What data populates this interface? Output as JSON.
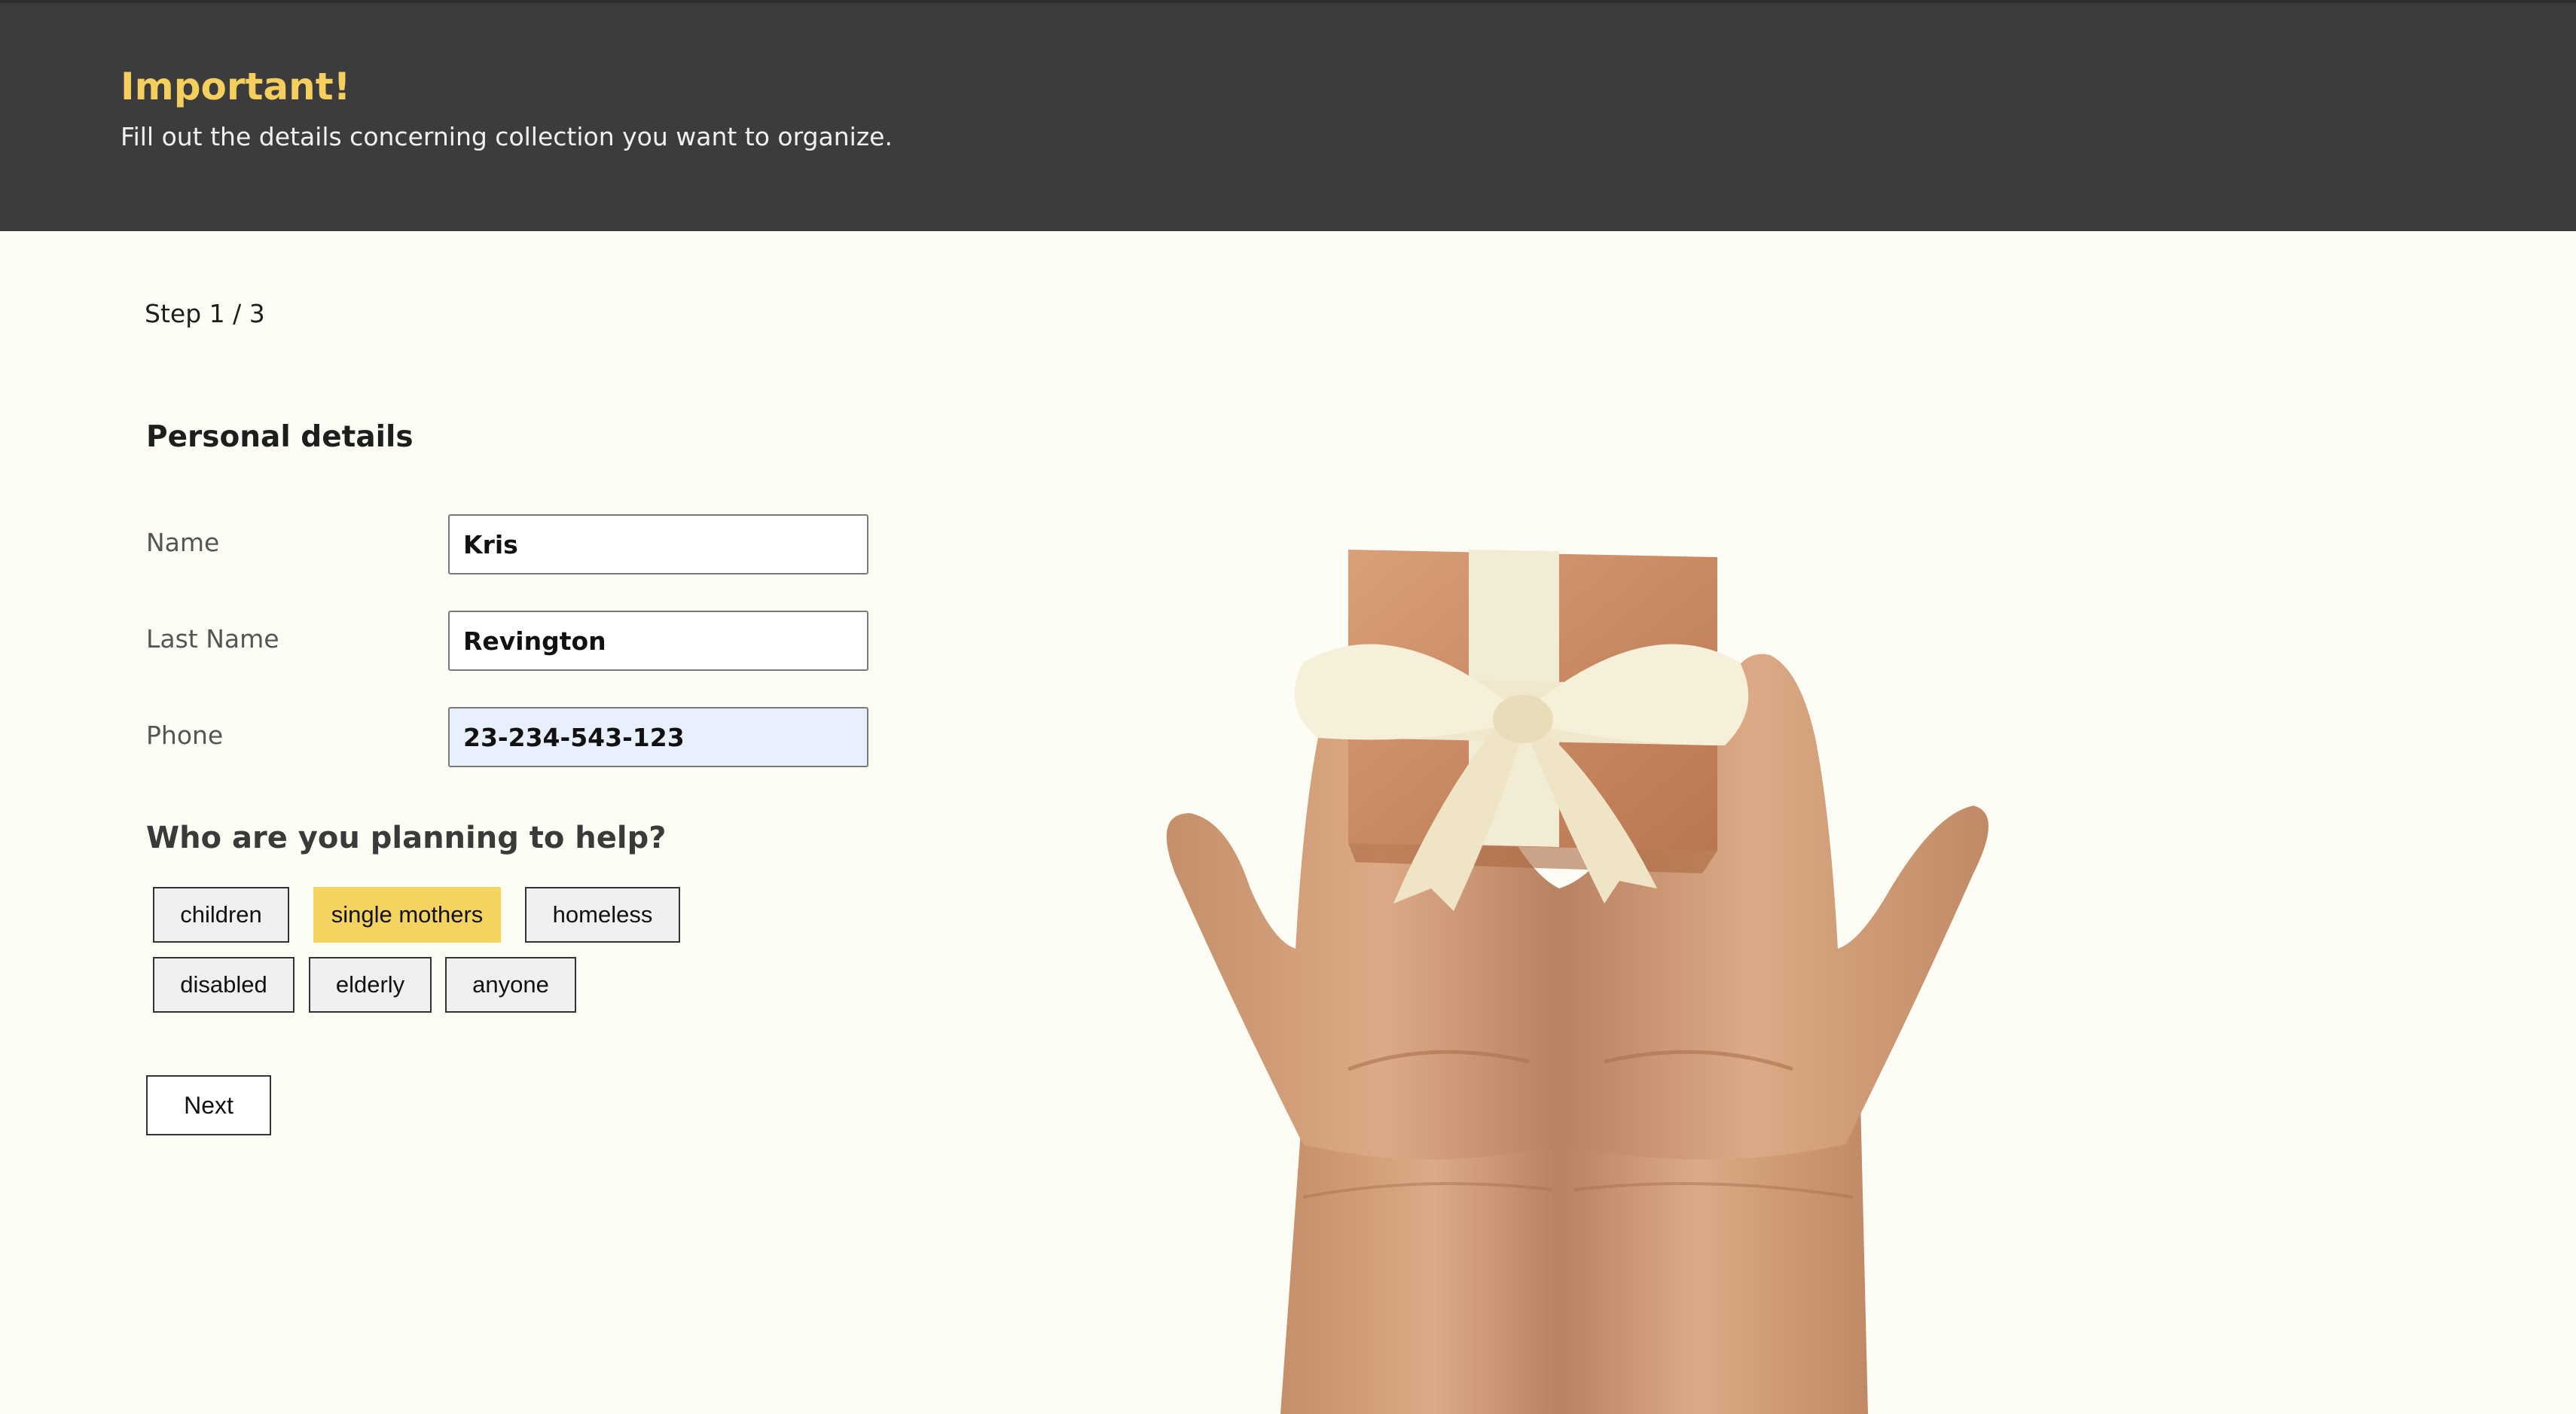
{
  "header": {
    "title": "Important!",
    "subtitle": "Fill out the details concerning collection you want to organize."
  },
  "form": {
    "step": "Step 1 / 3",
    "section_title": "Personal details",
    "fields": [
      {
        "label": "Name",
        "value": "Kris"
      },
      {
        "label": "Last Name",
        "value": "Revington"
      },
      {
        "label": "Phone",
        "value": "23-234-543-123"
      }
    ],
    "help_question": "Who are you planning to help?",
    "chips": [
      {
        "label": "children",
        "selected": false
      },
      {
        "label": "single mothers",
        "selected": true
      },
      {
        "label": "homeless",
        "selected": false
      },
      {
        "label": "disabled",
        "selected": false
      },
      {
        "label": "elderly",
        "selected": false
      },
      {
        "label": "anyone",
        "selected": false
      }
    ],
    "next_label": "Next"
  },
  "image": {
    "name": "hands-holding-gift"
  },
  "colors": {
    "header_bg": "#3c3c3c",
    "accent": "#f4cf5d",
    "page_bg": "#fefdf5",
    "chip_selected": "#f4d361"
  }
}
